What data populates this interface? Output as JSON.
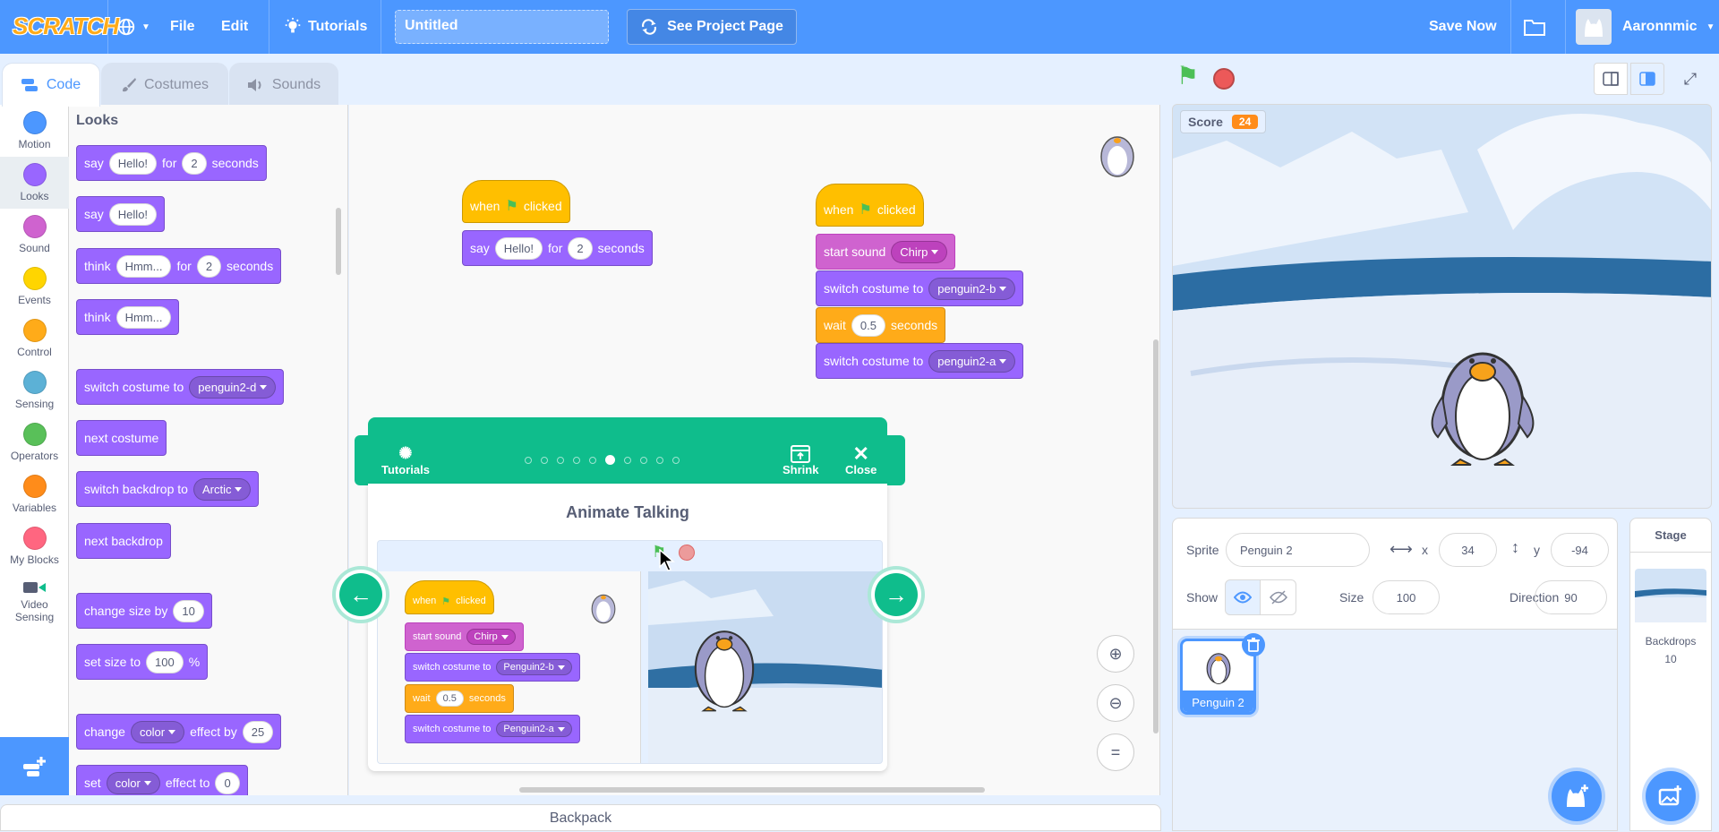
{
  "menubar": {
    "logo": "SCRATCH",
    "file": "File",
    "edit": "Edit",
    "tutorials": "Tutorials",
    "project_title": "Untitled",
    "see_project_page": "See Project Page",
    "save_now": "Save Now",
    "username": "Aaronnmic"
  },
  "tabs": {
    "code": "Code",
    "costumes": "Costumes",
    "sounds": "Sounds"
  },
  "categories": [
    {
      "label": "Motion",
      "color": "#4c97ff"
    },
    {
      "label": "Looks",
      "color": "#9966ff"
    },
    {
      "label": "Sound",
      "color": "#cf63cf"
    },
    {
      "label": "Events",
      "color": "#ffd500"
    },
    {
      "label": "Control",
      "color": "#ffab19"
    },
    {
      "label": "Sensing",
      "color": "#5cb1d6"
    },
    {
      "label": "Operators",
      "color": "#59c059"
    },
    {
      "label": "Variables",
      "color": "#ff8c1a"
    },
    {
      "label": "My Blocks",
      "color": "#ff6680"
    },
    {
      "label": "Video Sensing",
      "color": "#0fbd8c"
    }
  ],
  "palette": {
    "heading": "Looks",
    "say_for": {
      "say": "say",
      "msg": "Hello!",
      "for": "for",
      "secs": "2",
      "seconds": "seconds"
    },
    "say": {
      "say": "say",
      "msg": "Hello!"
    },
    "think_for": {
      "think": "think",
      "msg": "Hmm...",
      "for": "for",
      "secs": "2",
      "seconds": "seconds"
    },
    "think": {
      "think": "think",
      "msg": "Hmm..."
    },
    "switch_costume": {
      "text": "switch costume to",
      "value": "penguin2-d"
    },
    "next_costume": "next costume",
    "switch_backdrop": {
      "text": "switch backdrop to",
      "value": "Arctic"
    },
    "next_backdrop": "next backdrop",
    "change_size": {
      "text": "change size by",
      "value": "10"
    },
    "set_size": {
      "text": "set size to",
      "value": "100",
      "unit": "%"
    },
    "change_effect": {
      "change": "change",
      "effect": "color",
      "by": "effect by",
      "value": "25"
    },
    "set_effect": {
      "set": "set",
      "effect": "color",
      "to": "effect to",
      "value": "0"
    }
  },
  "script1": {
    "when": "when",
    "clicked": "clicked",
    "say": "say",
    "msg": "Hello!",
    "for": "for",
    "secs": "2",
    "seconds": "seconds"
  },
  "script2": {
    "when": "when",
    "clicked": "clicked",
    "start_sound": "start sound",
    "sound": "Chirp",
    "switch1": "switch costume to",
    "costume1": "penguin2-b",
    "wait": "wait",
    "wait_val": "0.5",
    "seconds": "seconds",
    "switch2": "switch costume to",
    "costume2": "penguin2-a"
  },
  "tutorial": {
    "tutorials_label": "Tutorials",
    "shrink": "Shrink",
    "close": "Close",
    "title": "Animate Talking",
    "steps_total": 10,
    "step_current": 6,
    "script": {
      "when": "when",
      "clicked": "clicked",
      "start_sound": "start sound",
      "sound": "Chirp",
      "switch1": "switch costume to",
      "costume1": "Penguin2-b",
      "wait": "wait",
      "wait_val": "0.5",
      "seconds": "seconds",
      "switch2": "switch costume to",
      "costume2": "Penguin2-a"
    }
  },
  "stage": {
    "score_label": "Score",
    "score_value": "24"
  },
  "sprite_info": {
    "sprite_label": "Sprite",
    "sprite_name": "Penguin 2",
    "x_label": "x",
    "x": "34",
    "y_label": "y",
    "y": "-94",
    "show_label": "Show",
    "size_label": "Size",
    "size": "100",
    "direction_label": "Direction",
    "direction": "90"
  },
  "sprites": [
    {
      "name": "Penguin 2"
    }
  ],
  "stage_panel": {
    "title": "Stage",
    "backdrops_label": "Backdrops",
    "backdrops_count": "10"
  },
  "backpack": "Backpack"
}
